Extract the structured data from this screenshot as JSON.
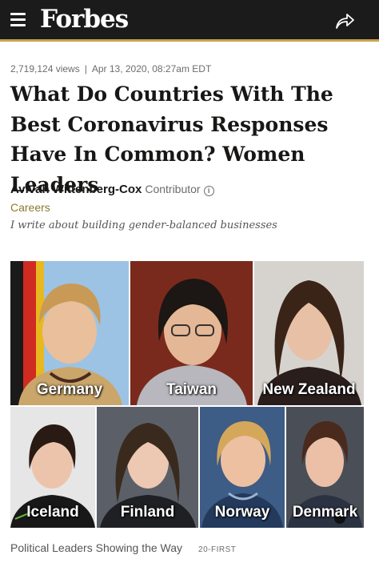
{
  "header": {
    "logo": "Forbes",
    "menu_icon": "hamburger-menu-icon",
    "share_icon": "share-arrow-icon",
    "bar_color": "#1b1b1b",
    "accent_color": "#c9a34a"
  },
  "article": {
    "views": "2,719,124 views",
    "separator": "|",
    "date": "Apr 13, 2020, 08:27am EDT",
    "headline": "What Do Countries With The Best Coronavirus Responses Have In Common? Women Leaders",
    "author": "Avivah Wittenberg-Cox",
    "role": "Contributor",
    "info_icon": "info-circle-icon",
    "channel": "Careers",
    "tagline": "I write about building gender-balanced businesses"
  },
  "image": {
    "tiles": [
      {
        "label": "Germany"
      },
      {
        "label": "Taiwan"
      },
      {
        "label": "New Zealand"
      },
      {
        "label": "Iceland"
      },
      {
        "label": "Finland"
      },
      {
        "label": "Norway"
      },
      {
        "label": "Denmark"
      }
    ],
    "caption": "Political Leaders Showing the Way",
    "credit": "20-FIRST"
  }
}
